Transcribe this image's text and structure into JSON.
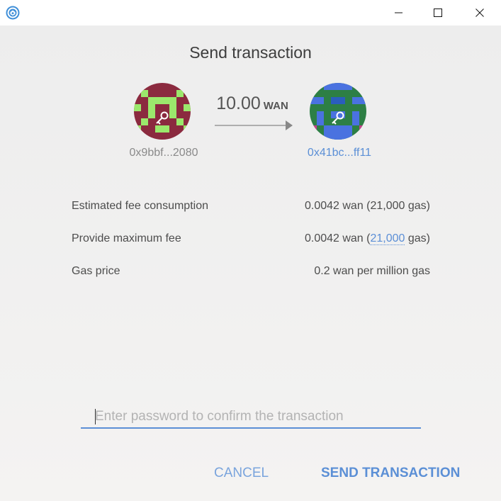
{
  "window": {
    "app_icon": "wanwallet-icon",
    "controls": [
      "minimize-icon",
      "maximize-icon",
      "close-icon"
    ]
  },
  "dialog": {
    "title": "Send transaction",
    "from_address": "0x9bbf...2080",
    "to_address": "0x41bc...ff11",
    "amount": "10.00",
    "unit": "WAN",
    "fee_rows": [
      {
        "label": "Estimated fee consumption",
        "value": "0.0042 wan (21,000 gas)"
      },
      {
        "label": "Provide maximum fee",
        "value_prefix": "0.0042 wan (",
        "gas_link": "21,000",
        "value_suffix": " gas)"
      },
      {
        "label": "Gas price",
        "value": "0.2 wan per million gas"
      }
    ],
    "password": {
      "value": "",
      "placeholder": "Enter password to confirm the transaction"
    },
    "cancel_label": "CANCEL",
    "send_label": "SEND TRANSACTION"
  },
  "colors": {
    "accent": "#5b8fd6",
    "from_identicon_bg": "#8b2a3f",
    "from_identicon_fg": "#9be86c",
    "to_identicon_bg": "#2d7f45",
    "to_identicon_fg": "#4a72e0"
  }
}
